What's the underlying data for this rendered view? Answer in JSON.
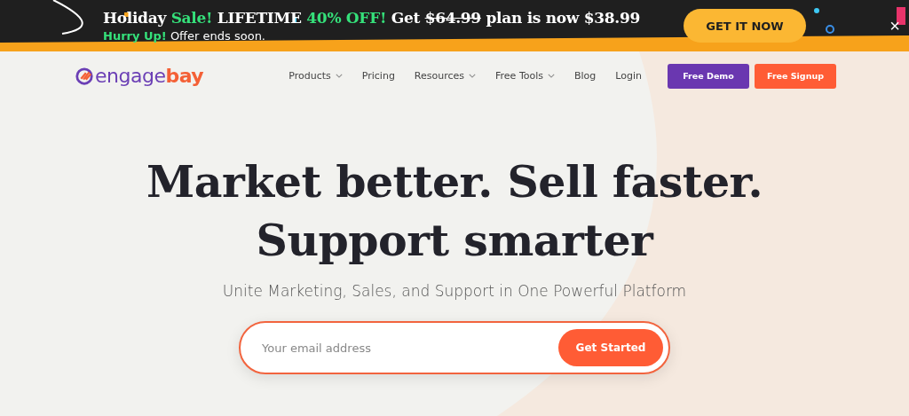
{
  "promo_banner": {
    "headline": [
      {
        "text": "Holiday",
        "kind": "plain"
      },
      {
        "text": "Sale!",
        "kind": "highlight"
      },
      {
        "text": "LIFETIME",
        "kind": "plain"
      },
      {
        "text": "40% OFF!",
        "kind": "highlight"
      },
      {
        "text": "Get",
        "kind": "plain"
      },
      {
        "text": "$64.99",
        "kind": "strike"
      },
      {
        "text": "plan is now $38.99",
        "kind": "plain"
      }
    ],
    "subline": [
      {
        "text": "Hurry Up!",
        "kind": "highlight"
      },
      {
        "text": "Offer ends soon.",
        "kind": "plain"
      }
    ],
    "cta": "GET IT NOW",
    "close": "×"
  },
  "navbar": {
    "logo": [
      {
        "text": "engage",
        "kind": "primary"
      },
      {
        "text": "bay",
        "kind": "accent"
      }
    ],
    "items": [
      {
        "label": "Products",
        "dropdown": true
      },
      {
        "label": "Pricing",
        "dropdown": false
      },
      {
        "label": "Resources",
        "dropdown": true
      },
      {
        "label": "Free Tools",
        "dropdown": true
      },
      {
        "label": "Blog",
        "dropdown": false
      },
      {
        "label": "Login",
        "dropdown": false
      }
    ],
    "buttons": [
      {
        "label": "Free Demo",
        "kind": "primary"
      },
      {
        "label": "Free Signup",
        "kind": "accent"
      }
    ]
  },
  "hero": {
    "title_lines": [
      "Market better. Sell faster.",
      "Support smarter"
    ],
    "subtitle": "Unite Marketing, Sales, and Support in One Powerful Platform",
    "email_field": {
      "placeholder": "Your email address"
    },
    "submit": "Get Started"
  }
}
